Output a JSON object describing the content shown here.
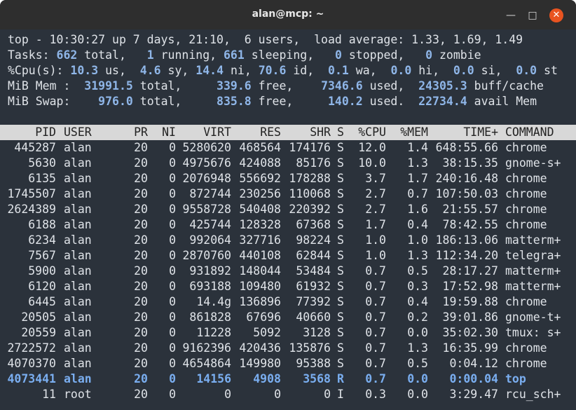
{
  "window": {
    "title": "alan@mcp: ~",
    "min_label": "—",
    "max_label": "□",
    "close_label": "✕"
  },
  "summary": {
    "line1": "top - 10:30:27 up 7 days, 21:10,  6 users,  load average: 1.33, 1.69, 1.49",
    "tasks": {
      "label": "Tasks:",
      "total": "662",
      "total_lbl": " total,",
      "running": "1",
      "running_lbl": " running,",
      "sleeping": "661",
      "sleeping_lbl": " sleeping,",
      "stopped": "0",
      "stopped_lbl": " stopped,",
      "zombie": "0",
      "zombie_lbl": " zombie"
    },
    "cpu": {
      "label": "%Cpu(s):",
      "us": "10.3",
      "sy": "4.6",
      "ni": "14.4",
      "id": "70.6",
      "wa": "0.1",
      "hi": "0.0",
      "si": "0.0",
      "st": "0.0"
    },
    "mem": {
      "label": "MiB Mem :",
      "total": "31991.5",
      "free": "339.6",
      "used": "7346.6",
      "cache": "24305.3",
      "cache_lbl": "buff/cache"
    },
    "swap": {
      "label": "MiB Swap:",
      "total": "976.0",
      "free": "835.8",
      "used": "140.2",
      "avail": "22734.4",
      "avail_lbl": "avail Mem"
    }
  },
  "columns": [
    "PID",
    "USER",
    "PR",
    "NI",
    "VIRT",
    "RES",
    "SHR",
    "S",
    "%CPU",
    "%MEM",
    "TIME+",
    "COMMAND"
  ],
  "processes": [
    [
      "445287",
      "alan",
      "20",
      "0",
      "5280620",
      "468564",
      "174176",
      "S",
      "12.0",
      "1.4",
      "648:55.66",
      "chrome"
    ],
    [
      "5630",
      "alan",
      "20",
      "0",
      "4975676",
      "424088",
      "85176",
      "S",
      "10.0",
      "1.3",
      "38:15.35",
      "gnome-s+"
    ],
    [
      "6135",
      "alan",
      "20",
      "0",
      "2076948",
      "556692",
      "178288",
      "S",
      "3.7",
      "1.7",
      "240:16.48",
      "chrome"
    ],
    [
      "1745507",
      "alan",
      "20",
      "0",
      "872744",
      "230256",
      "110068",
      "S",
      "2.7",
      "0.7",
      "107:50.03",
      "chrome"
    ],
    [
      "2624389",
      "alan",
      "20",
      "0",
      "9558728",
      "540408",
      "220392",
      "S",
      "2.7",
      "1.6",
      "21:55.57",
      "chrome"
    ],
    [
      "6188",
      "alan",
      "20",
      "0",
      "425744",
      "128328",
      "67368",
      "S",
      "1.7",
      "0.4",
      "78:42.55",
      "chrome"
    ],
    [
      "6234",
      "alan",
      "20",
      "0",
      "992064",
      "327716",
      "98224",
      "S",
      "1.0",
      "1.0",
      "186:13.06",
      "matterm+"
    ],
    [
      "7567",
      "alan",
      "20",
      "0",
      "2870760",
      "440108",
      "62844",
      "S",
      "1.0",
      "1.3",
      "112:34.20",
      "telegra+"
    ],
    [
      "5900",
      "alan",
      "20",
      "0",
      "931892",
      "148044",
      "53484",
      "S",
      "0.7",
      "0.5",
      "28:17.27",
      "matterm+"
    ],
    [
      "6120",
      "alan",
      "20",
      "0",
      "693188",
      "109480",
      "61932",
      "S",
      "0.7",
      "0.3",
      "17:52.98",
      "matterm+"
    ],
    [
      "6445",
      "alan",
      "20",
      "0",
      "14.4g",
      "136896",
      "77392",
      "S",
      "0.7",
      "0.4",
      "19:59.88",
      "chrome"
    ],
    [
      "20505",
      "alan",
      "20",
      "0",
      "861828",
      "67696",
      "40660",
      "S",
      "0.7",
      "0.2",
      "39:01.86",
      "gnome-t+"
    ],
    [
      "20559",
      "alan",
      "20",
      "0",
      "11228",
      "5092",
      "3128",
      "S",
      "0.7",
      "0.0",
      "35:02.30",
      "tmux: s+"
    ],
    [
      "2722572",
      "alan",
      "20",
      "0",
      "9162396",
      "420436",
      "135876",
      "S",
      "0.7",
      "1.3",
      "16:35.99",
      "chrome"
    ],
    [
      "4070370",
      "alan",
      "20",
      "0",
      "4654864",
      "149980",
      "95388",
      "S",
      "0.7",
      "0.5",
      "0:04.12",
      "chrome"
    ],
    [
      "4073441",
      "alan",
      "20",
      "0",
      "14156",
      "4908",
      "3568",
      "R",
      "0.7",
      "0.0",
      "0:00.04",
      "top"
    ],
    [
      "11",
      "root",
      "20",
      "0",
      "0",
      "0",
      "0",
      "I",
      "0.3",
      "0.0",
      "3:29.47",
      "rcu_sch+"
    ]
  ],
  "highlight_row": 15,
  "colors": {
    "terminal_bg": "#2b323b",
    "header_bg": "#d8d8d8",
    "accent_blue": "#7aaef0",
    "close_btn": "#e95420"
  }
}
